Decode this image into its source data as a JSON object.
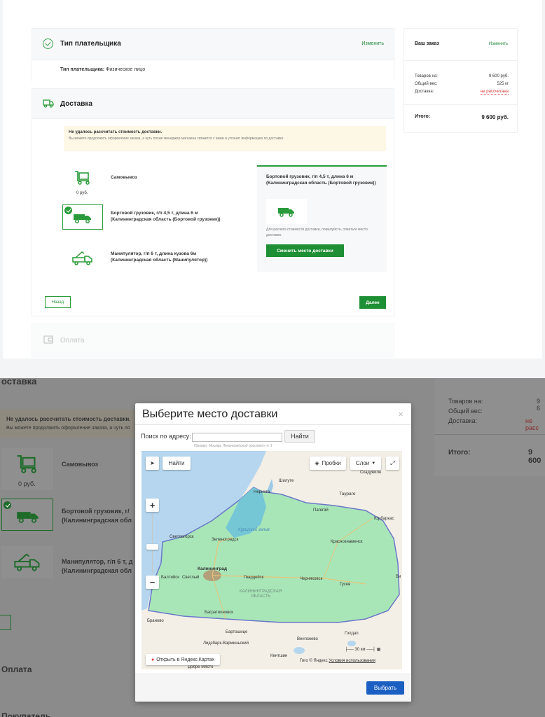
{
  "checkout": {
    "payer": {
      "title": "Тип плательщика",
      "edit": "Изменить",
      "line_label": "Тип плательщика:",
      "line_value": "Физическое лицо"
    },
    "delivery": {
      "title": "Доставка",
      "warning_title": "Не удалось рассчитать стоимость доставки.",
      "warning_text": "Вы можете продолжить оформление заказа, а чуть позже менеджер магазина свяжется с вами и уточнит информацию по доставке.",
      "options": [
        {
          "label": "Самовывоз",
          "price": "0 руб.",
          "icon": "cart-icon"
        },
        {
          "label_line1": "Бортовой грузовик, г/п 4,5 т, длина 6 м",
          "label_line2": "(Калининградская область (Бортовой грузовик))",
          "icon": "truck-icon",
          "selected": true
        },
        {
          "label_line1": "Манипулятор, г/п 6 т, длина кузова 6м",
          "label_line2": "(Калининградская область (Манипулятор))",
          "icon": "crane-truck-icon"
        }
      ],
      "detail": {
        "title": "Бортовой грузовик, г/п 4,5 т, длина 6 м (Калининградская область (Бортовой грузовик))",
        "text": "Для расчета стоимости доставки, пожалуйста, отметьте место доставки.",
        "button": "Сменить место доставки"
      },
      "back": "Назад",
      "next": "Далее"
    },
    "payment": {
      "title": "Оплата"
    }
  },
  "order": {
    "title": "Ваш заказ",
    "edit": "Изменить",
    "rows": [
      {
        "label": "Товаров на:",
        "value": "9 600 руб."
      },
      {
        "label": "Общий вес:",
        "value": "525 кг"
      },
      {
        "label": "Доставка:",
        "value": "не рассчитана"
      }
    ],
    "total_label": "Итого:",
    "total_value": "9 600 руб."
  },
  "bottom": {
    "section_title": "оставка",
    "warning_title": "Не удалось рассчитать стоимость доставки.",
    "warning_text": "Вы можете продолжить оформление заказа, а чуть по",
    "opt1_label": "Самовывоз",
    "opt1_price": "0 руб.",
    "opt2_line1": "Бортовой грузовик, г/",
    "opt2_line2": "(Калининградская обл",
    "opt3_line1": "Манипулятор, г/п 6 т, д",
    "opt3_line2": "(Калининградская обл",
    "payment_title": "Оплата",
    "buyer_title": "Покупатель",
    "order_rows": [
      {
        "label": "Товаров на:",
        "value": "9 6"
      },
      {
        "label": "Общий вес:",
        "value": ""
      },
      {
        "label": "Доставка:",
        "value": "не расс"
      }
    ],
    "total_label": "Итого:",
    "total_value": "9 600"
  },
  "modal": {
    "title": "Выберите место доставки",
    "close": "×",
    "search_label": "Поиск по адресу:",
    "search_value": "",
    "search_button": "Найти",
    "search_hint": "Пример: Москва, Ленинградский проспект, д. 1",
    "map": {
      "find_button": "Найти",
      "traffic_button": "Пробки",
      "layers_button": "Слои",
      "zoom_in": "+",
      "zoom_out": "−",
      "open_yandex": "Открыть в Яндекс.Картах",
      "scale": "30 км",
      "copyright": "Гиго © Яндекс",
      "terms": "Условия использования",
      "region": "КАЛИНИНГРАДСКАЯ\nОБЛАСТЬ",
      "water": "Куршский залив",
      "places": [
        "Скадувиле",
        "Шилуте",
        "Таураге",
        "Нерингa",
        "Пагегяй",
        "Юрбаркас",
        "Светлогорск",
        "Зеленоградск",
        "Краснознаменск",
        "Калининград",
        "Светлый",
        "Гвардейск",
        "Черняховск",
        "Гусев",
        "Балтийск",
        "Браново",
        "Багратионовск",
        "Бартошице",
        "Голдап",
        "Венгожево",
        "Лидзбарк-Варминьский",
        "Кентшин",
        "Добре Място",
        "Ви"
      ]
    },
    "select_button": "Выбрать"
  },
  "colors": {
    "accent_green": "#1e8f34",
    "accent_blue": "#1b5fc2",
    "map_region": "#a8e6b8",
    "map_water": "#b5d6ee"
  }
}
